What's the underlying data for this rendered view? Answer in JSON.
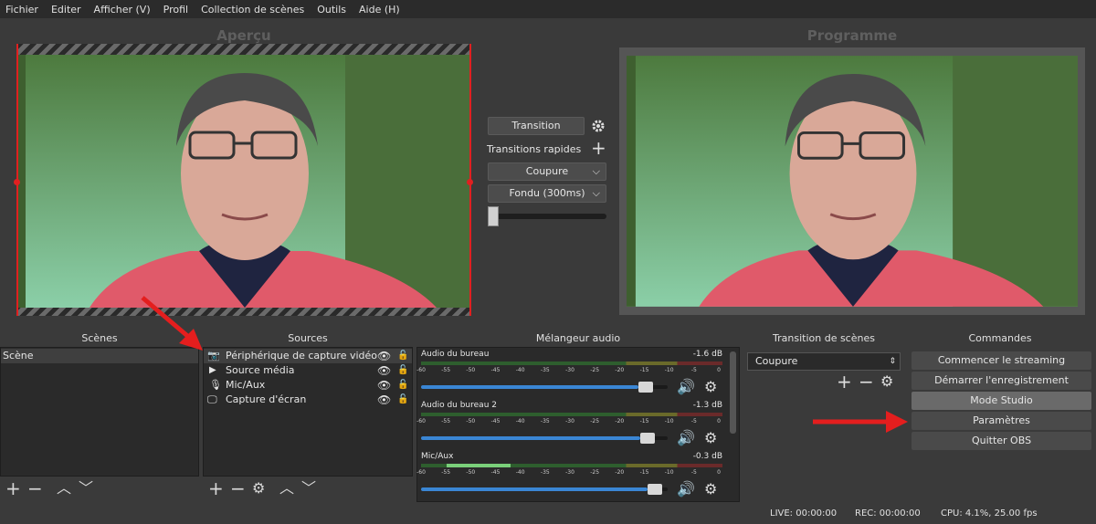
{
  "menu": [
    "Fichier",
    "Editer",
    "Afficher (V)",
    "Profil",
    "Collection de scènes",
    "Outils",
    "Aide (H)"
  ],
  "preview_label": "Aperçu",
  "program_label": "Programme",
  "transition": {
    "button": "Transition",
    "quick_label": "Transitions rapides",
    "select1": "Coupure",
    "select2": "Fondu (300ms)",
    "slider_value": 0
  },
  "panels": {
    "scenes": {
      "title": "Scènes",
      "items": [
        "Scène"
      ]
    },
    "sources": {
      "title": "Sources",
      "items": [
        {
          "label": "Périphérique de capture vidéo",
          "icon": "camera-icon"
        },
        {
          "label": "Source média",
          "icon": "play-icon"
        },
        {
          "label": "Mic/Aux",
          "icon": "microphone-icon"
        },
        {
          "label": "Capture d'écran",
          "icon": "monitor-icon"
        }
      ]
    },
    "mixer": {
      "title": "Mélangeur audio",
      "channels": [
        {
          "name": "Audio du bureau",
          "db": "-1.6 dB",
          "fader": 0.95
        },
        {
          "name": "Audio du bureau 2",
          "db": "-1.3 dB",
          "fader": 0.96
        },
        {
          "name": "Mic/Aux",
          "db": "-0.3 dB",
          "fader": 0.99
        }
      ],
      "scale": [
        "-60",
        "-55",
        "-50",
        "-45",
        "-40",
        "-35",
        "-30",
        "-25",
        "-20",
        "-15",
        "-10",
        "-5",
        "0"
      ]
    },
    "scene_transition": {
      "title": "Transition de scènes",
      "select": "Coupure"
    },
    "commands": {
      "title": "Commandes",
      "buttons": [
        "Commencer le streaming",
        "Démarrer l'enregistrement",
        "Mode Studio",
        "Paramètres",
        "Quitter OBS"
      ]
    }
  },
  "status": {
    "live": "LIVE: 00:00:00",
    "rec": "REC: 00:00:00",
    "cpu": "CPU: 4.1%, 25.00 fps"
  },
  "colors": {
    "accent_red": "#e02020",
    "fader_blue": "#3a86d4",
    "meter_green": "#3c8a3c"
  }
}
